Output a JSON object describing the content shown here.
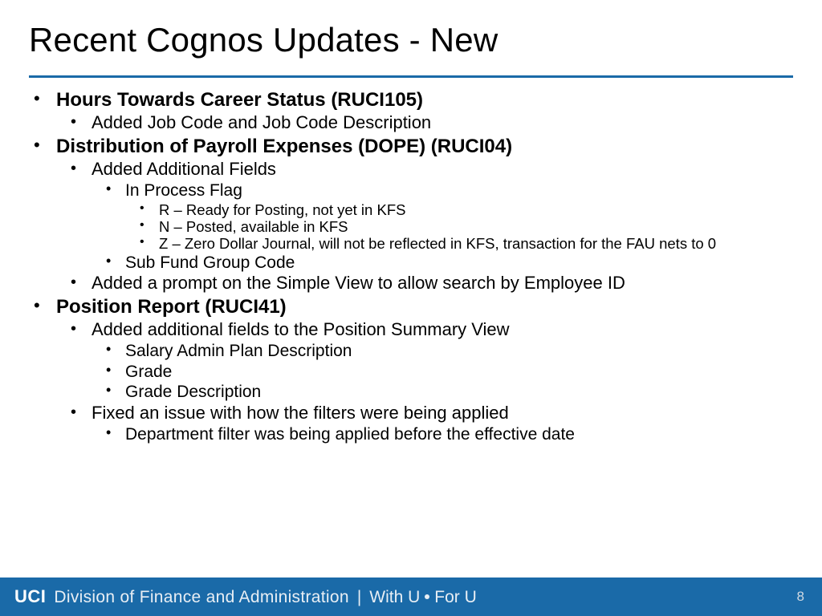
{
  "title": "Recent Cognos Updates - New",
  "bullets": {
    "b1": {
      "label": "Hours Towards Career Status (RUCI105)",
      "sub": {
        "s1": "Added Job Code and Job Code Description"
      }
    },
    "b2": {
      "label": "Distribution of Payroll Expenses (DOPE) (RUCI04)",
      "sub": {
        "s1": "Added Additional Fields",
        "s1a": "In Process Flag",
        "s1a1": "R – Ready for Posting, not yet in KFS",
        "s1a2": "N – Posted, available in KFS",
        "s1a3": "Z – Zero Dollar Journal, will not be reflected in KFS, transaction for the FAU nets to 0",
        "s1b": "Sub Fund Group Code",
        "s2": "Added a prompt on the Simple View to allow search by Employee ID"
      }
    },
    "b3": {
      "label": "Position Report (RUCI41)",
      "sub": {
        "s1": "Added additional fields to the Position Summary View",
        "s1a": "Salary Admin Plan Description",
        "s1b": "Grade",
        "s1c": "Grade Description",
        "s2": "Fixed an issue with how the filters were being applied",
        "s2a": "Department filter was being applied before the effective date"
      }
    }
  },
  "footer": {
    "org": "UCI",
    "division": "Division of Finance and Administration",
    "separator": "|",
    "tagline_pre": "With U",
    "tagline_post": "For U"
  },
  "page_number": "8"
}
